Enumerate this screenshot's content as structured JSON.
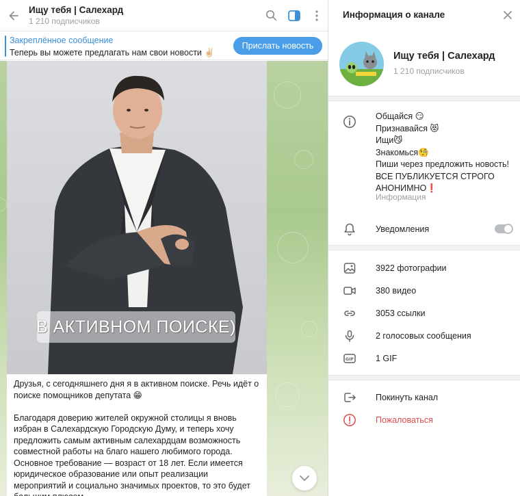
{
  "chat_header": {
    "title": "Ищу тебя | Салехард",
    "subscribers": "1 210 подписчиков"
  },
  "pinned": {
    "title": "Закреплённое сообщение",
    "text": "Теперь вы можете предлагать нам свои новости ✌🏻",
    "button": "Прислать новость"
  },
  "post": {
    "photo_caption": "В АКТИВНОМ ПОИСКЕ)",
    "paragraphs": [
      "Друзья, с сегодняшнего дня я в активном поиске. Речь идёт о поиске помощников депутата 😁",
      "Благодаря доверию жителей окружной столицы я вновь избран в Салехардскую Городскую Думу, и теперь хочу предложить самым активным салехардцам возможность совместной работы на благо нашего любимого города. Основное требование — возраст от 18 лет. Если имеется юридическое образование или опыт реализации мероприятий и социально значимых проектов, то это будет большим плюсом."
    ]
  },
  "info": {
    "title": "Информация о канале",
    "channel_name": "Ищу тебя | Салехард",
    "subscribers": "1 210 подписчиков",
    "about_lines": [
      "Общайся 😏",
      "Признавайся 😻",
      "Ищи😼",
      "Знакомься🧐",
      "Пиши через предложить новость!",
      "ВСЕ ПУБЛИКУЕТСЯ СТРОГО",
      "АНОНИМНО❗"
    ],
    "about_label": "Информация",
    "notifications_label": "Уведомления",
    "notifications_on": false,
    "media": {
      "photos": "3922 фотографии",
      "videos": "380 видео",
      "links": "3053 ссылки",
      "voice": "2 голосовых сообщения",
      "gif": "1 GIF"
    },
    "leave": "Покинуть канал",
    "report": "Пожаловаться"
  },
  "colors": {
    "accent": "#3a8fd9",
    "button": "#4a9ee8",
    "danger": "#e04b4b",
    "muted": "#9aa0a6"
  },
  "icons": [
    "back-arrow-icon",
    "search-icon",
    "sidebar-toggle-icon",
    "more-vertical-icon",
    "close-icon",
    "info-icon",
    "bell-icon",
    "photo-icon",
    "video-icon",
    "link-icon",
    "microphone-icon",
    "gif-icon",
    "leave-icon",
    "report-icon",
    "chevron-down-icon"
  ]
}
